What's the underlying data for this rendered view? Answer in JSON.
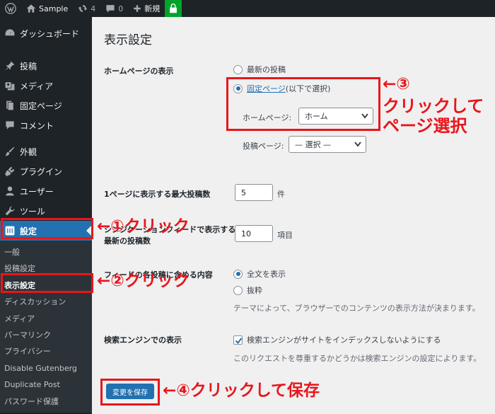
{
  "admin_bar": {
    "site_name": "Sample",
    "updates_count": "4",
    "comments_count": "0",
    "new_label": "新規"
  },
  "sidebar": {
    "dashboard": "ダッシュボード",
    "posts": "投稿",
    "media": "メディア",
    "pages": "固定ページ",
    "comments": "コメント",
    "appearance": "外観",
    "plugins": "プラグイン",
    "users": "ユーザー",
    "tools": "ツール",
    "settings": "設定",
    "submenu": [
      {
        "label": "一般"
      },
      {
        "label": "投稿設定"
      },
      {
        "label": "表示設定"
      },
      {
        "label": "ディスカッション"
      },
      {
        "label": "メディア"
      },
      {
        "label": "パーマリンク"
      },
      {
        "label": "プライバシー"
      },
      {
        "label": "Disable Gutenberg"
      },
      {
        "label": "Duplicate Post"
      },
      {
        "label": "パスワード保護"
      }
    ]
  },
  "main": {
    "title": "表示設定",
    "homepage": {
      "label": "ホームページの表示",
      "option_latest": "最新の投稿",
      "option_static_link": "固定ページ",
      "option_static_suffix": " (以下で選択)",
      "homepage_label": "ホームページ:",
      "homepage_value": "ホーム",
      "postspage_label": "投稿ページ:",
      "postspage_value": "— 選択 —"
    },
    "per_page": {
      "label": "1ページに表示する最大投稿数",
      "value": "5",
      "unit": "件"
    },
    "feed_count": {
      "label_line1": "シンジケーションフィードで表示する",
      "label_line2": "最新の投稿数",
      "value": "10",
      "unit": "項目"
    },
    "feed_content": {
      "label": "フィードの各投稿に含める内容",
      "option_full": "全文を表示",
      "option_excerpt": "抜粋",
      "description": "テーマによって、ブラウザーでのコンテンツの表示方法が決まります。"
    },
    "search_engine": {
      "label": "検索エンジンでの表示",
      "checkbox_label": "検索エンジンがサイトをインデックスしないようにする",
      "description": "このリクエストを尊重するかどうかは検索エンジンの設定によります。"
    },
    "save_button": "変更を保存"
  },
  "annotations": {
    "step1": "←①クリック",
    "step2": "←②クリック",
    "step3": "←③",
    "step3_line1": "クリックして",
    "step3_line2": "ページ選択",
    "step4": "←④クリックして保存",
    "color": "#e8161b"
  }
}
